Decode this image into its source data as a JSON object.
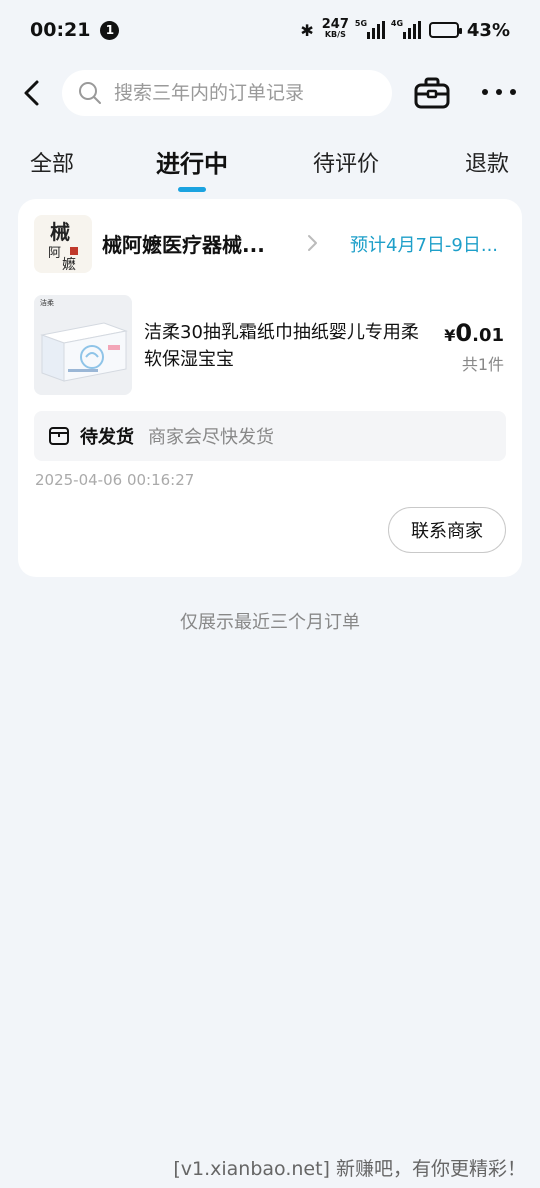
{
  "status_bar": {
    "time": "00:21",
    "notification_count": "1",
    "net_speed": "247",
    "net_speed_unit": "KB/S",
    "sim1_label": "5G",
    "sim2_label": "4G",
    "battery_level": 0.43,
    "battery_percent": "43%"
  },
  "header": {
    "search_placeholder": "搜索三年内的订单记录",
    "icons": [
      "back-arrow-icon",
      "search-icon",
      "bag-icon",
      "more-icon"
    ]
  },
  "tabs": [
    {
      "label": "全部",
      "active": false
    },
    {
      "label": "进行中",
      "active": true
    },
    {
      "label": "待评价",
      "active": false
    },
    {
      "label": "退款",
      "active": false
    }
  ],
  "order": {
    "shop_name": "械阿嬷医疗器械...",
    "shop_logo_text": "械阿嬷",
    "delivery_estimate": "预计4月7日-9日...",
    "product_brand": "洁柔",
    "product_title": "洁柔30抽乳霜纸巾抽纸婴儿专用柔软保湿宝宝",
    "price_symbol": "¥",
    "price_int": "0",
    "price_dec": ".01",
    "quantity": "共1件",
    "status_main": "待发货",
    "status_sub": "商家会尽快发货",
    "order_time": "2025-04-06 00:16:27",
    "contact_label": "联系商家"
  },
  "footer_note": "仅展示最近三个月订单",
  "watermark": "[v1.xianbao.net] 新赚吧，有你更精彩！",
  "colors": {
    "accent": "#1ba3e0",
    "delivery_text": "#1e9fc9",
    "background": "#f2f5f9"
  }
}
